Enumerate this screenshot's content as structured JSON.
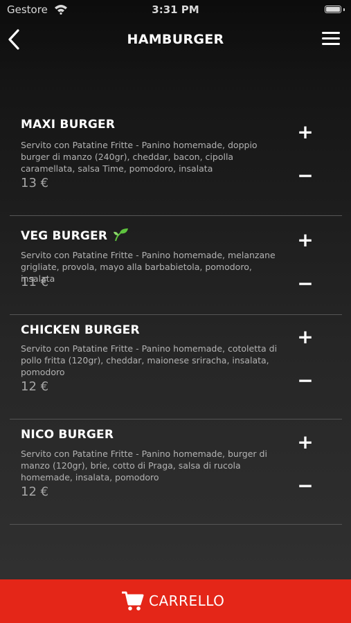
{
  "status_bar": {
    "carrier": "Gestore",
    "time": "3:31 PM"
  },
  "header": {
    "title": "HAMBURGER"
  },
  "items": [
    {
      "name": "MAXI BURGER",
      "description": "Servito con Patatine Fritte - Panino homemade, doppio burger di manzo (240gr), cheddar, bacon, cipolla caramellata, salsa Time, pomodoro, insalata",
      "price": "13 €",
      "plus": "+",
      "minus": "−"
    },
    {
      "name": "VEG BURGER",
      "description": "Servito con Patatine Fritte - Panino homemade, melanzane grigliate, provola, mayo alla barbabietola, pomodoro, insalata",
      "price": "11 €",
      "plus": "+",
      "minus": "−"
    },
    {
      "name": "CHICKEN BURGER",
      "description": "Servito con Patatine Fritte - Panino homemade, cotoletta di pollo fritta (120gr), cheddar, maionese sriracha, insalata, pomodoro",
      "price": "12 €",
      "plus": "+",
      "minus": "−"
    },
    {
      "name": "NICO BURGER",
      "description": "Servito con Patatine Fritte - Panino homemade, burger di manzo (120gr), brie, cotto di Praga, salsa di rucola homemade, insalata, pomodoro",
      "price": "12 €",
      "plus": "+",
      "minus": "−"
    }
  ],
  "cart": {
    "label": "CARRELLO"
  },
  "icons": {
    "back": "chevron-left-icon",
    "menu": "hamburger-menu-icon",
    "veg": "leaf-icon",
    "cart": "shopping-cart-icon"
  },
  "colors": {
    "accent": "#e42618",
    "background_top": "#0c0c0c",
    "background_bottom": "#333333"
  }
}
